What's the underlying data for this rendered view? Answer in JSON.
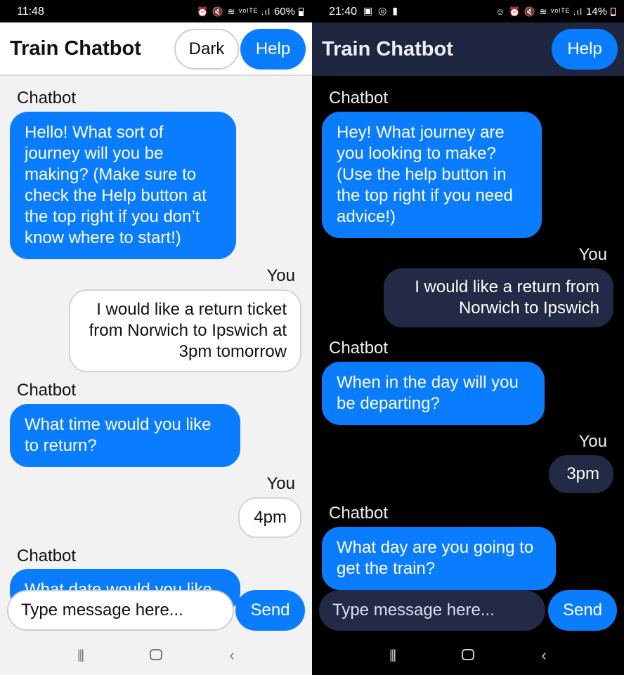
{
  "light": {
    "status": {
      "time": "11:48",
      "battery": "60%",
      "icons": "⏰ 🔇 ≋ ᵛᵒˡᵀᴱ .ıl"
    },
    "title": "Train Chatbot",
    "dark_button": "Dark",
    "help_button": "Help",
    "messages": [
      {
        "sender": "Chatbot",
        "text": "Hello! What sort of journey will you be making? (Make sure to check the Help button at the top right if you don’t know where to start!)"
      },
      {
        "sender": "You",
        "text": "I would like a return ticket from Norwich to Ipswich at 3pm tomorrow"
      },
      {
        "sender": "Chatbot",
        "text": "What time would you like to return?"
      },
      {
        "sender": "You",
        "text": "4pm"
      },
      {
        "sender": "Chatbot",
        "text": "What date would you like"
      }
    ],
    "input_placeholder": "Type message here...",
    "send_button": "Send"
  },
  "dark": {
    "status": {
      "time": "21:40",
      "battery": "14%",
      "icons": "☺ ⏰ 🔇 ≋ ᵛᵒˡᵀᴱ .ıl",
      "left_icons": "▣ ◎ ▮"
    },
    "title": "Train Chatbot",
    "help_button": "Help",
    "messages": [
      {
        "sender": "Chatbot",
        "text": "Hey! What journey are you looking to make? (Use the help button in the top right if you need advice!)"
      },
      {
        "sender": "You",
        "text": "I would like a return from Norwich to Ipswich"
      },
      {
        "sender": "Chatbot",
        "text": "When in the day will you be departing?"
      },
      {
        "sender": "You",
        "text": "3pm"
      },
      {
        "sender": "Chatbot",
        "text": "What day are you going to get the train?"
      }
    ],
    "input_placeholder": "Type message here...",
    "send_button": "Send"
  },
  "navbar": {
    "recents": "|||",
    "back": "‹"
  },
  "colors": {
    "accent": "#0a7cff",
    "dark_header": "#1f2640",
    "dark_user_bubble": "#222a45",
    "light_bg": "#f2f2f2"
  }
}
